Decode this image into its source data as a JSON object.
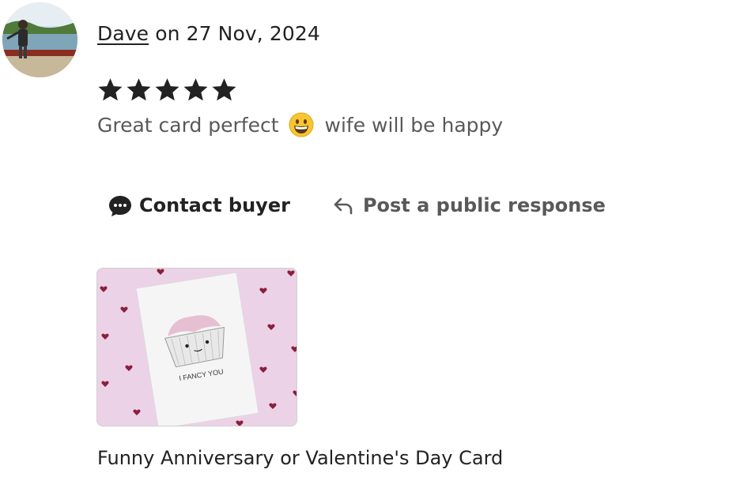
{
  "review": {
    "reviewer_name": "Dave",
    "date_text": "on 27 Nov, 2024",
    "rating": 5,
    "rating_max": 5,
    "text_before_emoji": "Great card perfect",
    "emoji": "grinning-face",
    "text_after_emoji": "wife will be happy"
  },
  "actions": {
    "contact_label": "Contact buyer",
    "contact_icon": "chat-bubble-icon",
    "respond_label": "Post a public response",
    "respond_icon": "reply-arrow-icon"
  },
  "product": {
    "image_caption": "I FANCY YOU",
    "title": "Funny Anniversary or Valentine's Day Card"
  },
  "colors": {
    "text_primary": "#222222",
    "text_secondary": "#595959",
    "card_background": "#ecd2e7",
    "heart": "#8a1f3d",
    "star": "#222222"
  }
}
